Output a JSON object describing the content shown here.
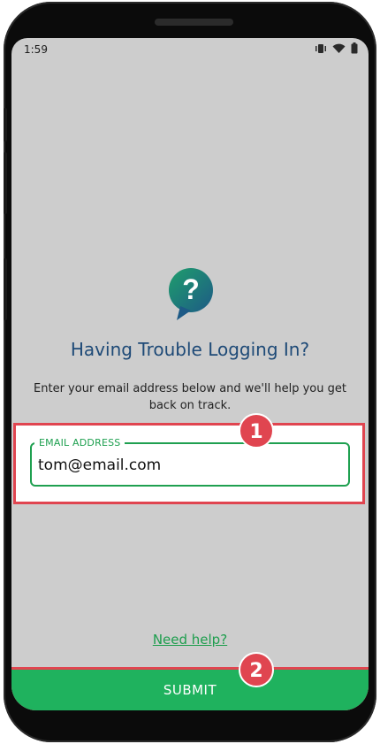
{
  "status_bar": {
    "time": "1:59",
    "icons": [
      "vibrate-icon",
      "wifi-icon",
      "battery-icon"
    ]
  },
  "page": {
    "logo": "help-question-icon",
    "title": "Having Trouble Logging In?",
    "description": "Enter your email address below and we'll help you get back on track."
  },
  "email": {
    "label": "EMAIL ADDRESS",
    "value": "tom@email.com"
  },
  "links": {
    "need_help": "Need help?"
  },
  "submit": {
    "label": "SUBMIT"
  },
  "annotations": {
    "badge1": "1",
    "badge2": "2"
  },
  "colors": {
    "accent_green": "#1fb25e",
    "title_blue": "#1e4a77",
    "highlight_red": "#e04550"
  }
}
